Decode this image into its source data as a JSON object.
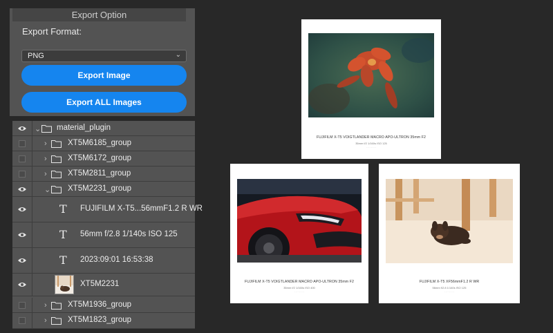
{
  "export": {
    "title": "Export Option",
    "format_label": "Export Format:",
    "format_value": "PNG",
    "export_image_label": "Export Image",
    "export_all_label": "Export ALL Images",
    "accent_color": "#1585ef"
  },
  "layers": {
    "group_name": "material_plugin",
    "items": [
      {
        "name": "XT5M6185_group"
      },
      {
        "name": "XT5M6172_group"
      },
      {
        "name": "XT5M2811_group"
      },
      {
        "name": "XT5M2231_group"
      },
      {
        "name": "FUJIFILM X-T5...56mmF1.2 R WR"
      },
      {
        "name": "56mm f/2.8 1/140s ISO 125"
      },
      {
        "name": "2023:09:01 16:53:38"
      },
      {
        "name": "XT5M2231"
      },
      {
        "name": "XT5M1936_group"
      },
      {
        "name": "XT5M1823_group"
      }
    ]
  },
  "canvas": {
    "print1": {
      "caption": "FUJIFILM X-T5 VOIGTLANDER MACRO APO-ULTRON 35mm F2",
      "info": "35mm f/2 1/160s ISO 125"
    },
    "print2": {
      "caption": "FUJIFILM X-T5 VOIGTLANDER MACRO APO-ULTRON 35mm F2",
      "info": "35mm f/2 1/160s ISO 400"
    },
    "print3": {
      "caption": "FUJIFILM X-T5 XF56mmF1.2 R WR",
      "info": "56mm f/2.8 1/140s ISO 125"
    }
  }
}
